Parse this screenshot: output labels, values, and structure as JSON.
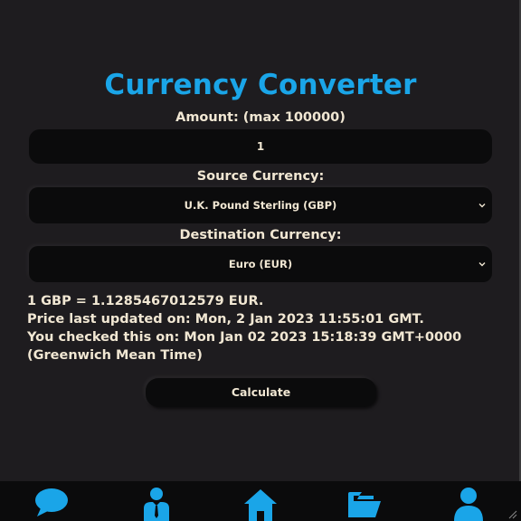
{
  "title": "Currency Converter",
  "amount": {
    "label": "Amount: (max 100000)",
    "value": "1"
  },
  "source": {
    "label": "Source Currency:",
    "selected": "U.K. Pound Sterling (GBP)"
  },
  "destination": {
    "label": "Destination Currency:",
    "selected": "Euro (EUR)"
  },
  "result": {
    "rate_line": "1 GBP = 1.1285467012579 EUR.",
    "updated_line": "Price last updated on: Mon, 2 Jan 2023 11:55:01 GMT.",
    "checked_line": "You checked this on: Mon Jan 02 2023 15:18:39 GMT+0000 (Greenwich Mean Time)"
  },
  "calculate_label": "Calculate",
  "nav": {
    "items": [
      "chat-icon",
      "businessman-icon",
      "home-icon",
      "folder-icon",
      "user-icon"
    ]
  },
  "colors": {
    "accent": "#1aa5e8",
    "background": "#1e1c1f",
    "field": "#0b0b0c",
    "text": "#f1e7d3"
  }
}
